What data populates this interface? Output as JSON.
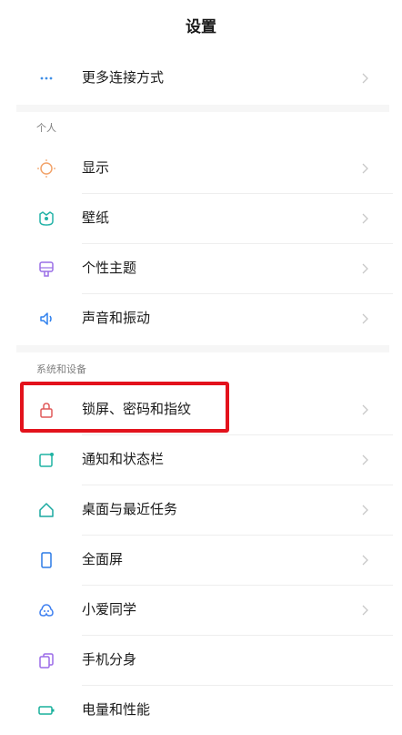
{
  "header": {
    "title": "设置"
  },
  "top": {
    "more_connections": {
      "label": "更多连接方式",
      "icon": "more-dots-icon"
    }
  },
  "sections": {
    "personal": {
      "title": "个人",
      "items": [
        {
          "label": "显示",
          "icon": "sun-icon"
        },
        {
          "label": "壁纸",
          "icon": "wallpaper-icon"
        },
        {
          "label": "个性主题",
          "icon": "theme-icon"
        },
        {
          "label": "声音和振动",
          "icon": "speaker-icon"
        }
      ]
    },
    "system": {
      "title": "系统和设备",
      "items": [
        {
          "label": "锁屏、密码和指纹",
          "icon": "lock-icon"
        },
        {
          "label": "通知和状态栏",
          "icon": "notification-icon"
        },
        {
          "label": "桌面与最近任务",
          "icon": "home-icon"
        },
        {
          "label": "全面屏",
          "icon": "phone-screen-icon"
        },
        {
          "label": "小爱同学",
          "icon": "assistant-icon"
        },
        {
          "label": "手机分身",
          "icon": "dual-copy-icon"
        },
        {
          "label": "电量和性能",
          "icon": "battery-icon"
        }
      ]
    }
  },
  "colors": {
    "accent_blue": "#3f8fe6",
    "display_orange": "#f2a36a",
    "wallpaper_teal": "#24b3a8",
    "theme_purple": "#9a6ee6",
    "sound_blue": "#2f80ed",
    "lock_red": "#e05a5a",
    "notify_teal": "#1fb3a3",
    "home_teal": "#1aa9a0",
    "screen_blue": "#2d7be6",
    "assistant_blue": "#3d7ff0",
    "dual_purple": "#9c6be8",
    "battery_teal": "#18b09c",
    "highlight_red": "#e3121c"
  }
}
